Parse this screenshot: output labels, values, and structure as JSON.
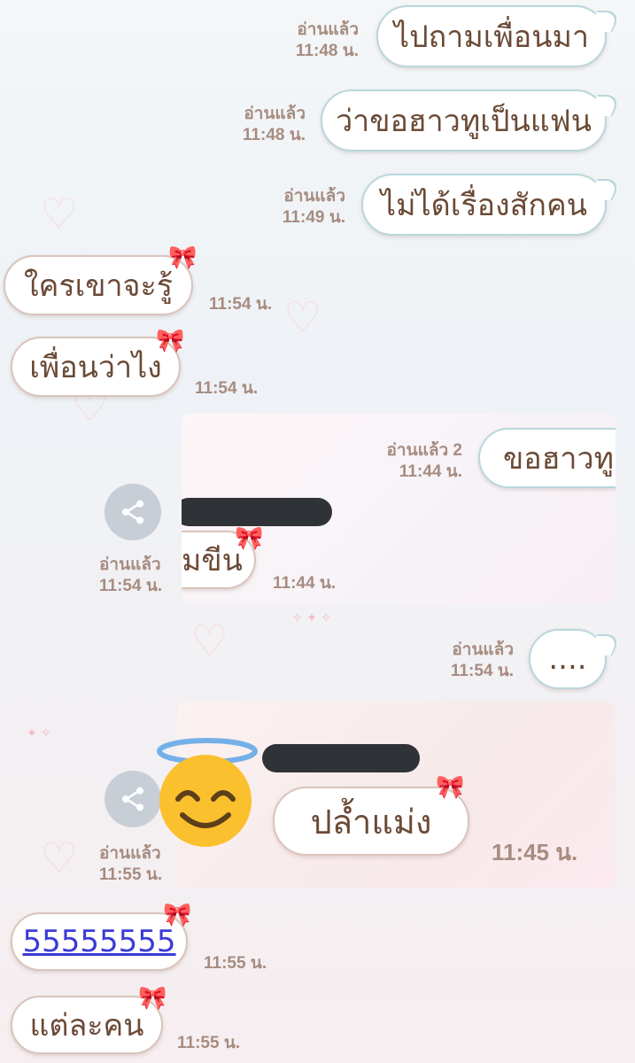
{
  "messages": [
    {
      "id": "m1",
      "direction": "outgoing",
      "text": "ไปถามเพื่อนมา",
      "read": "อ่านแล้ว",
      "time": "11:48 น."
    },
    {
      "id": "m2",
      "direction": "outgoing",
      "text": "ว่าขอฮาวทูเป็นแฟน",
      "read": "อ่านแล้ว",
      "time": "11:48 น."
    },
    {
      "id": "m3",
      "direction": "outgoing",
      "text": "ไม่ได้เรื่องสักคน",
      "read": "อ่านแล้ว",
      "time": "11:49 น."
    },
    {
      "id": "m4",
      "direction": "incoming",
      "text": "ใครเขาจะรู้",
      "time": "11:54 น."
    },
    {
      "id": "m5",
      "direction": "incoming",
      "text": "เพื่อนว่าไง",
      "time": "11:54 น."
    },
    {
      "id": "m7",
      "direction": "outgoing",
      "text": "....",
      "read": "อ่านแล้ว",
      "time": "11:54 น."
    },
    {
      "id": "m9",
      "direction": "incoming",
      "text": "55555555",
      "time": "11:55 น."
    },
    {
      "id": "m10",
      "direction": "incoming",
      "text": "แต่ละคน",
      "time": "11:55 น."
    }
  ],
  "forward1": {
    "read": "อ่านแล้ว",
    "time": "11:54 น.",
    "inner_out_text": "ขอฮาวทูเ",
    "inner_out_read": "อ่านแล้ว 2",
    "inner_out_time": "11:44 น.",
    "inner_in_text": "มขีน",
    "inner_in_time": "11:44 น."
  },
  "forward2": {
    "read": "อ่านแล้ว",
    "time": "11:55 น.",
    "inner_in_text": "ปล้ำแม่ง",
    "inner_in_time": "11:45 น."
  },
  "colors": {
    "outgoing_border": "#b9d7dc",
    "incoming_border": "#d9c4bb",
    "text": "#6b4a36",
    "meta": "#a78c80"
  },
  "icons": {
    "share": "share-icon",
    "bow": "bow-icon",
    "emoji": "smiling-face-with-halo"
  }
}
